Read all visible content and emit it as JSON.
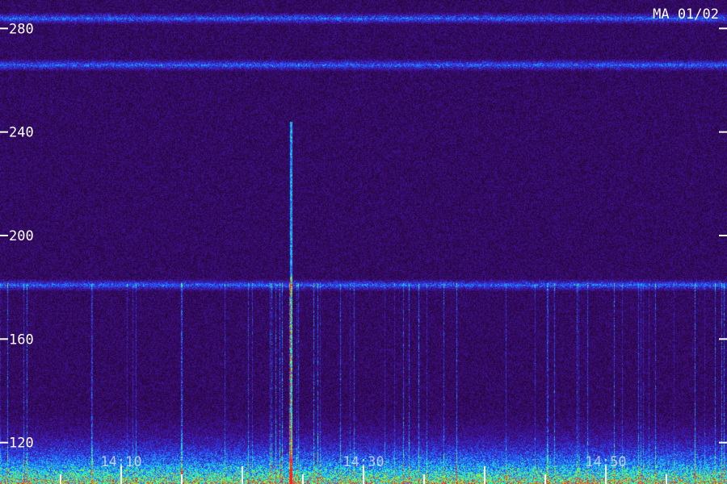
{
  "chart_data": {
    "type": "heatmap",
    "corner_label": "MA 01/02",
    "y_ticks": [
      {
        "value": 280,
        "label": "280"
      },
      {
        "value": 240,
        "label": "240"
      },
      {
        "value": 200,
        "label": "200"
      },
      {
        "value": 160,
        "label": "160"
      },
      {
        "value": 120,
        "label": "120"
      }
    ],
    "x_ticks": [
      {
        "value": "14:10",
        "label": "14:10"
      },
      {
        "value": "14:30",
        "label": "14:30"
      },
      {
        "value": "14:50",
        "label": "14:50"
      }
    ],
    "ylim": [
      104,
      291
    ],
    "x_minute_range": [
      "14:00",
      "15:00"
    ],
    "colormap": [
      "#1a0528",
      "#3a0a6a",
      "#3a1fc0",
      "#2060ff",
      "#20c0ff",
      "#20ffa0",
      "#c0ff20",
      "#ff2020"
    ],
    "horizontal_bands_y": [
      284,
      266,
      181
    ],
    "strong_vertical_line_x": "14:24"
  }
}
